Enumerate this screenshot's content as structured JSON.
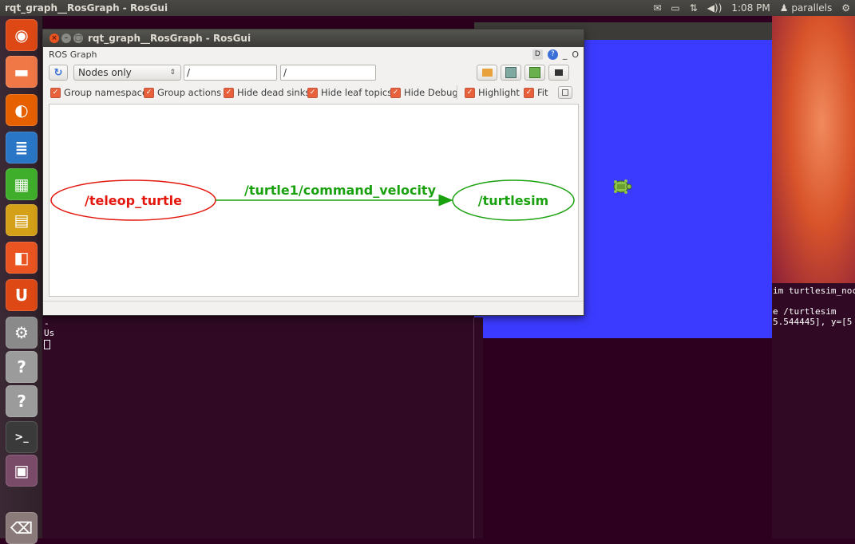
{
  "top_panel": {
    "app_title": "rqt_graph__RosGraph - RosGui",
    "indicators": [
      "✉",
      "▭",
      "⇅",
      "◀))"
    ],
    "clock": "1:08 PM",
    "user": "parallels"
  },
  "launcher": {
    "items": [
      {
        "name": "dash",
        "icon": "ubuntu-logo-icon",
        "color": "#dd4814"
      },
      {
        "name": "files",
        "icon": "folder-icon",
        "color": "#f07746"
      },
      {
        "name": "firefox",
        "icon": "firefox-icon",
        "color": "#e66000"
      },
      {
        "name": "writer",
        "icon": "document-icon",
        "color": "#2a76c6"
      },
      {
        "name": "calc",
        "icon": "spreadsheet-icon",
        "color": "#3fae2a"
      },
      {
        "name": "impress",
        "icon": "presentation-icon",
        "color": "#d4a017"
      },
      {
        "name": "software-center",
        "icon": "shopping-bag-icon",
        "color": "#e95420"
      },
      {
        "name": "ubuntu-one",
        "icon": "u-icon",
        "color": "#dd4814"
      },
      {
        "name": "system-settings",
        "icon": "gear-icon",
        "color": "#8a8a8a"
      },
      {
        "name": "unknown-1",
        "icon": "question-icon",
        "color": "#9b9b9b"
      },
      {
        "name": "unknown-2",
        "icon": "question-icon",
        "color": "#9b9b9b"
      },
      {
        "name": "terminal",
        "icon": "terminal-icon",
        "color": "#3a3a3a"
      },
      {
        "name": "workspace-switcher",
        "icon": "workspaces-icon",
        "color": "#7a4b68"
      },
      {
        "name": "trash",
        "icon": "trash-icon",
        "color": "#8a7a7a"
      }
    ]
  },
  "rosgui": {
    "title": "rqt_graph__RosGraph - RosGui",
    "plugin_label": "ROS Graph",
    "header_controls": [
      "D",
      "?",
      "_",
      "O"
    ],
    "toolbar": {
      "refresh_icon": "refresh-icon",
      "combo_value": "Nodes only",
      "filter_1": "/",
      "filter_2": "/",
      "right_buttons": [
        "open-icon",
        "save-dot-icon",
        "save-svg-icon",
        "save-image-icon"
      ]
    },
    "options": [
      {
        "label": "Group namespaces",
        "checked": true
      },
      {
        "label": "Group actions",
        "checked": true
      },
      {
        "label": "Hide dead sinks",
        "checked": true
      },
      {
        "label": "Hide leaf topics",
        "checked": true
      },
      {
        "label": "Hide Debug",
        "checked": true
      },
      {
        "label": "Highlight",
        "checked": true
      },
      {
        "label": "Fit",
        "checked": true
      }
    ],
    "graph": {
      "source_node": "/teleop_turtle",
      "edge_label": "/turtle1/command_velocity",
      "target_node": "/turtlesim",
      "source_color": "#e3170d",
      "target_color": "#1aa10f"
    }
  },
  "terminal_left": {
    "lines": [
      "-",
      "Us"
    ]
  },
  "terminal_right": {
    "lines": [
      "im turtlesim_noc",
      "",
      "e /turtlesim",
      "5.544445], y=[5"
    ]
  }
}
